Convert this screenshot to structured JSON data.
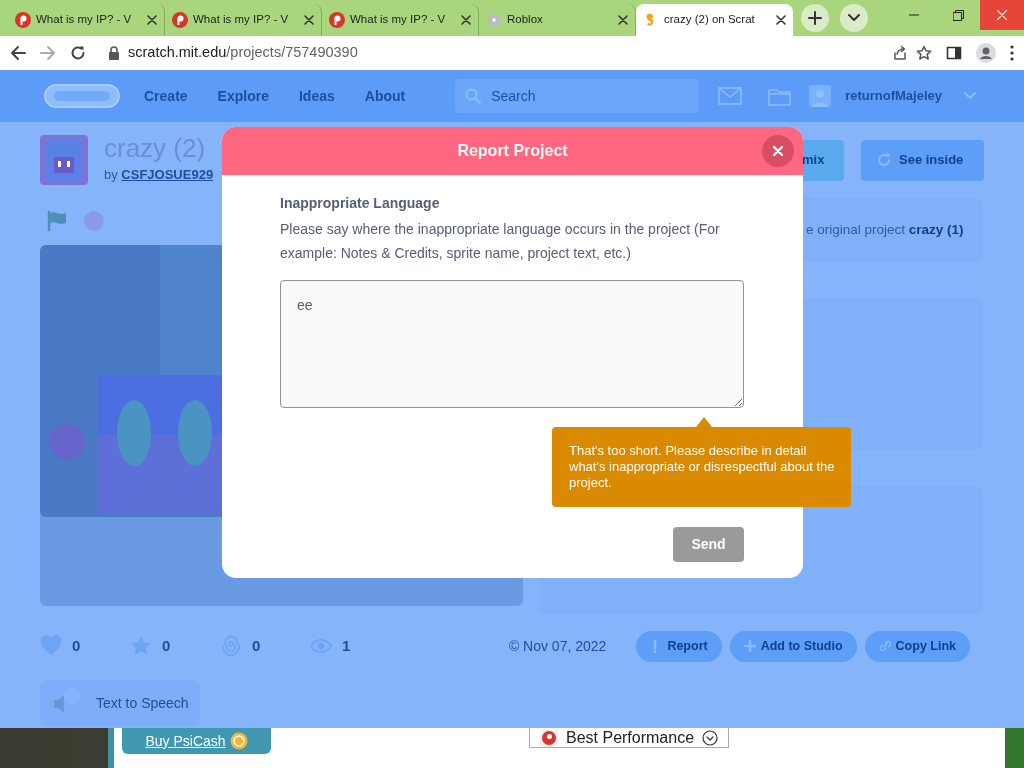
{
  "browser": {
    "tabs": [
      {
        "kind": "psiphon",
        "title": "What is my IP? - V",
        "selected": false
      },
      {
        "kind": "psiphon",
        "title": "What is my IP? - V",
        "selected": false
      },
      {
        "kind": "psiphon",
        "title": "What is my IP? - V",
        "selected": false
      },
      {
        "kind": "roblox",
        "title": "Roblox",
        "selected": false
      },
      {
        "kind": "scratch",
        "title": "crazy (2) on Scrat",
        "selected": true
      }
    ],
    "url_host": "scratch.mit.edu",
    "url_path": "/projects/757490390"
  },
  "navbar": {
    "links": [
      "Create",
      "Explore",
      "Ideas",
      "About"
    ],
    "search_placeholder": "Search",
    "username": "returnofMajeley"
  },
  "project": {
    "title": "crazy (2)",
    "by": "by",
    "author": "CSFJOSUE929",
    "remix_button": "mix",
    "see_inside_button": "See inside",
    "credit_text": "e original project",
    "credit_link": "crazy (1)",
    "stats": [
      {
        "kind": "love",
        "count": "0"
      },
      {
        "kind": "favorite",
        "count": "0"
      },
      {
        "kind": "remix",
        "count": "0"
      },
      {
        "kind": "view",
        "count": "1"
      }
    ],
    "date": "© Nov 07, 2022",
    "actions": [
      {
        "kind": "report",
        "label": "Report"
      },
      {
        "kind": "studio",
        "label": "Add to Studio"
      },
      {
        "kind": "link",
        "label": "Copy Link"
      }
    ],
    "extension": "Text to Speech"
  },
  "modal": {
    "title": "Report Project",
    "category": "Inappropriate Language",
    "prompt": "Please say where the inappropriate language occurs in the project (For example: Notes & Credits, sprite name, project text, etc.)",
    "value": "ee",
    "tooltip": "That's too short. Please describe in detail what's inappropriate or disrespectful about the project.",
    "send_button": "Send",
    "send_disabled": true
  },
  "taskbar_window": {
    "buy_button": "Buy PsiCash",
    "mode": "Best Performance"
  }
}
